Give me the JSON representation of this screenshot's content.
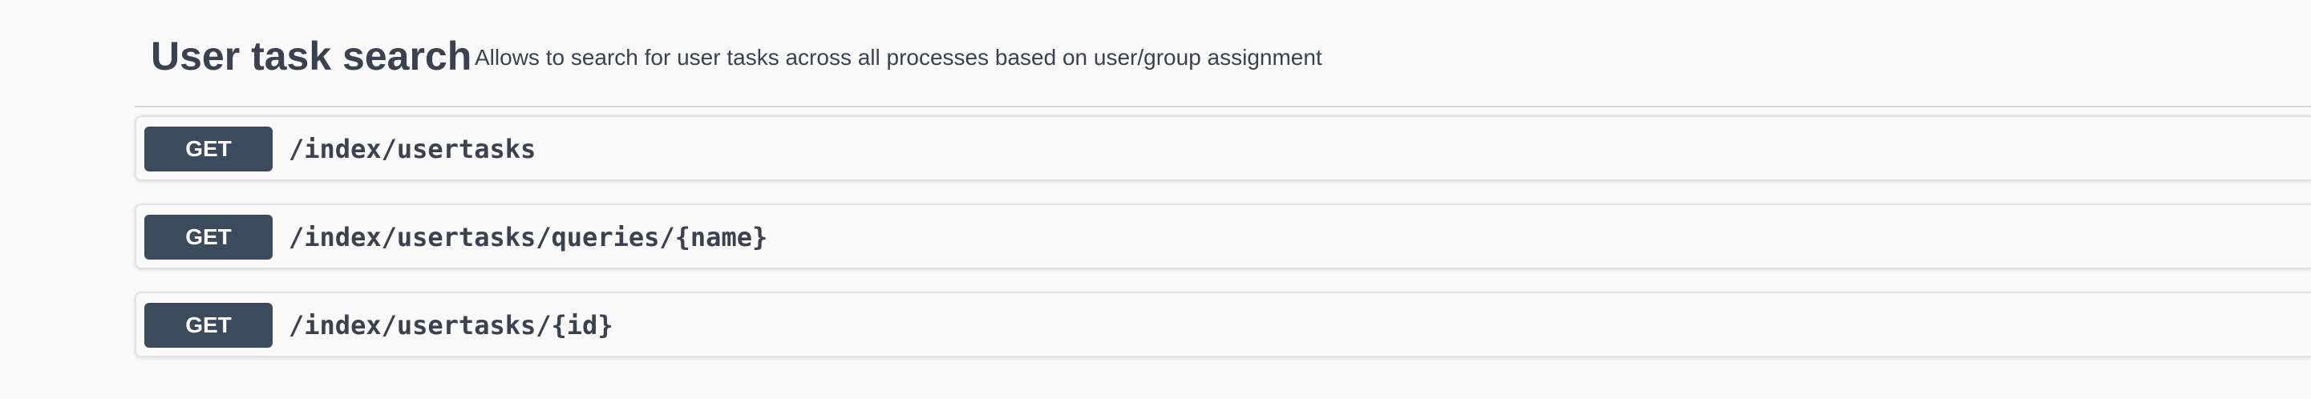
{
  "section": {
    "title": "User task search",
    "description": "Allows to search for user tasks across all processes based on user/group assignment"
  },
  "operations": [
    {
      "method": "GET",
      "path": "/index/usertasks"
    },
    {
      "method": "GET",
      "path": "/index/usertasks/queries/{name}"
    },
    {
      "method": "GET",
      "path": "/index/usertasks/{id}"
    }
  ],
  "colors": {
    "background": "#fafafa",
    "method_badge": "#3b4a5c",
    "text": "#3b4151"
  }
}
